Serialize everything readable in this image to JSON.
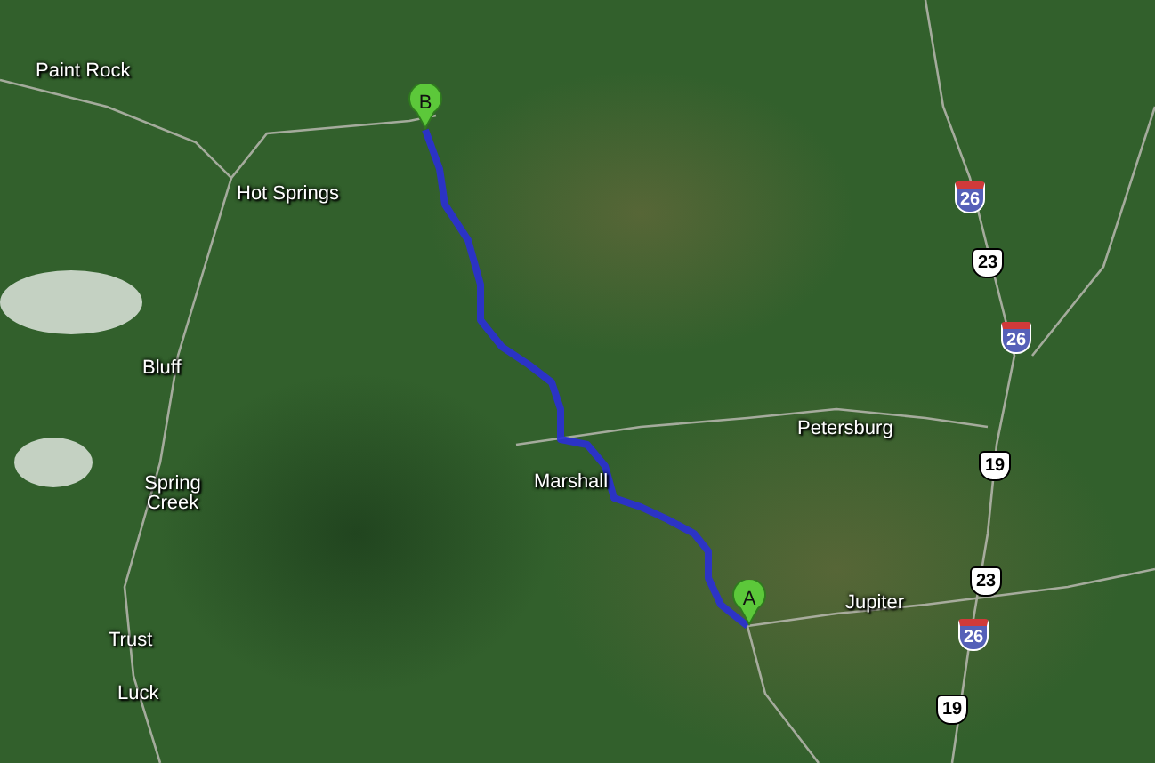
{
  "map": {
    "places": [
      {
        "name": "Paint Rock"
      },
      {
        "name": "Hot Springs"
      },
      {
        "name": "Bluff"
      },
      {
        "name": "Spring Creek"
      },
      {
        "name": "Trust"
      },
      {
        "name": "Luck"
      },
      {
        "name": "Marshall"
      },
      {
        "name": "Petersburg"
      },
      {
        "name": "Jupiter"
      }
    ],
    "shields": [
      {
        "kind": "interstate",
        "number": "26"
      },
      {
        "kind": "us",
        "number": "23"
      },
      {
        "kind": "interstate",
        "number": "26"
      },
      {
        "kind": "us",
        "number": "19"
      },
      {
        "kind": "us",
        "number": "23"
      },
      {
        "kind": "interstate",
        "number": "26"
      },
      {
        "kind": "us",
        "number": "19"
      }
    ],
    "markers": [
      {
        "label": "B"
      },
      {
        "label": "A"
      }
    ]
  }
}
